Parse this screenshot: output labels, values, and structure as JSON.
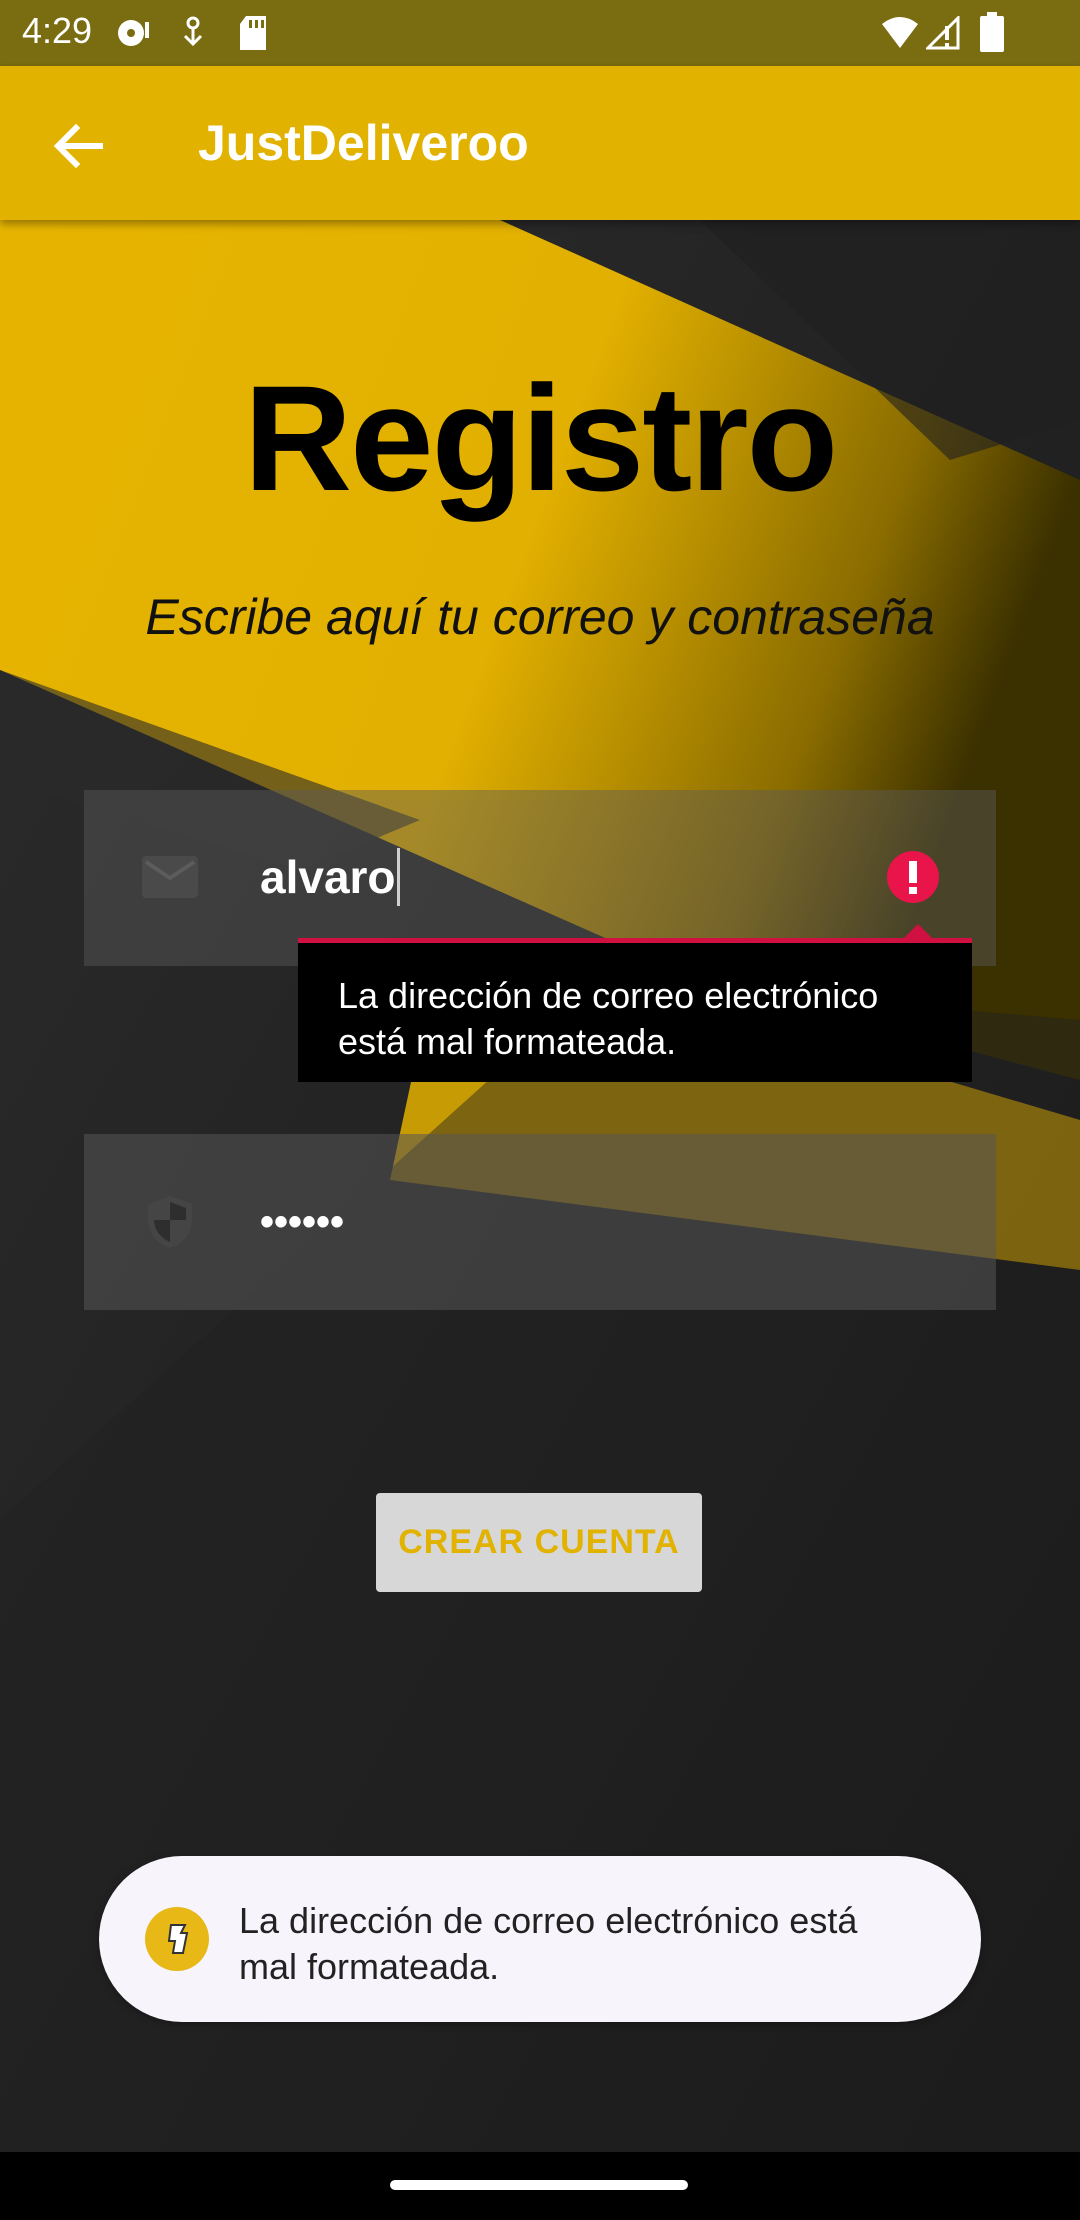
{
  "status_bar": {
    "time": "4:29",
    "icons": [
      "media-icon",
      "usb-debug-icon",
      "sd-card-icon",
      "wifi-icon",
      "signal-icon",
      "battery-icon"
    ]
  },
  "app_bar": {
    "title": "JustDeliveroo",
    "back_icon": "arrow-left-icon",
    "color": "#e2b200"
  },
  "headline": {
    "title": "Registro",
    "subtitle": "Escribe aquí tu correo y contraseña"
  },
  "form": {
    "email": {
      "value": "alvaro",
      "icon": "envelope-icon",
      "error_icon": "error-icon"
    },
    "error_tooltip": {
      "line1": "La dirección de correo electrónico",
      "line2": "está mal formateada."
    },
    "password": {
      "value": "••••••",
      "icon": "shield-icon"
    },
    "submit_label": "CREAR CUENTA"
  },
  "toast": {
    "icon": "app-logo-icon",
    "line1": "La dirección de correo electrónico está",
    "line2": "mal formateada."
  },
  "colors": {
    "accent": "#e2b200",
    "error": "#e8144a",
    "background": "#1c1c1c"
  }
}
